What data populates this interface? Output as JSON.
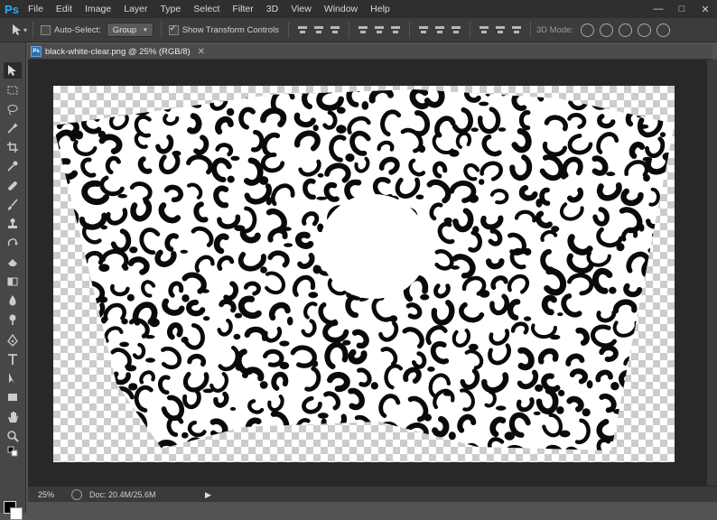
{
  "app": {
    "logo": "Ps"
  },
  "menu": [
    "File",
    "Edit",
    "Image",
    "Layer",
    "Type",
    "Select",
    "Filter",
    "3D",
    "View",
    "Window",
    "Help"
  ],
  "window_controls": {
    "minimize": "—",
    "maximize": "□",
    "close": "✕"
  },
  "options": {
    "auto_select_label": "Auto-Select:",
    "auto_select_checked": false,
    "group_value": "Group",
    "transform_label": "Show Transform Controls",
    "transform_checked": true,
    "mode3d_label": "3D Mode:"
  },
  "document": {
    "title": "black-white-clear.png @ 25% (RGB/8)",
    "close": "✕",
    "doc_icon": "Ps"
  },
  "status": {
    "zoom": "25%",
    "doc_size": "Doc: 20.4M/25.6M",
    "arrow": "▶"
  },
  "colors": {
    "foreground": "#000000",
    "background": "#ffffff",
    "ui_dark": "#282828"
  },
  "tools": [
    "move-icon",
    "marquee-icon",
    "lasso-icon",
    "magic-wand-icon",
    "crop-icon",
    "eyedropper-icon",
    "healing-brush-icon",
    "brush-icon",
    "clone-stamp-icon",
    "history-brush-icon",
    "eraser-icon",
    "gradient-icon",
    "blur-icon",
    "dodge-icon",
    "pen-icon",
    "type-icon",
    "path-selection-icon",
    "rectangle-icon",
    "hand-icon",
    "zoom-icon"
  ]
}
